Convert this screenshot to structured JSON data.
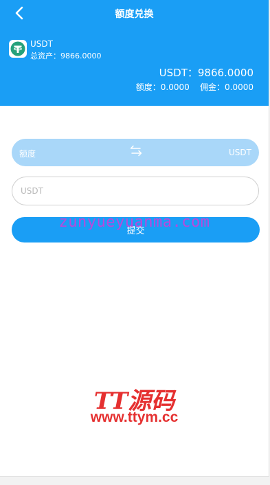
{
  "header": {
    "title": "额度兑换",
    "back_icon": "chevron-left-icon",
    "bg_color": "#1a9ef5"
  },
  "account": {
    "coin_icon": "tether-icon",
    "coin_icon_color": "#26a17b",
    "coin_name": "USDT",
    "total_assets": "总资产：9866.0000",
    "balance": "USDT：9866.0000",
    "quota_and_commission": "额度：0.0000    佣金：0.0000"
  },
  "exchange": {
    "from": "额度",
    "to": "USDT",
    "swap_icon": "swap-arrows-icon",
    "input_placeholder": "USDT",
    "input_value": "",
    "submit_label": "提交"
  },
  "watermarks": {
    "site": "zunyueyuanma.com",
    "logo": "TT源码",
    "url": "www.ttym.cc"
  }
}
